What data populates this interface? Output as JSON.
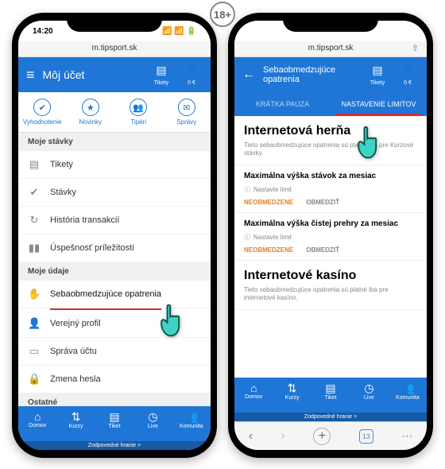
{
  "age_badge": "18+",
  "left": {
    "time": "14:20",
    "url": "m.tipsport.sk",
    "header_title": "Môj účet",
    "tikety_label": "Tikety",
    "balance": "0 €",
    "quick_tabs": [
      "Vyhodnotenie",
      "Novinky",
      "Tipéri",
      "Správy"
    ],
    "sec1": "Moje stávky",
    "rows1": [
      {
        "icon": "▤",
        "label": "Tikety"
      },
      {
        "icon": "✔",
        "label": "Stávky"
      },
      {
        "icon": "↻",
        "label": "História transakcií"
      },
      {
        "icon": "▮▮",
        "label": "Úspešnosť príležitostí"
      }
    ],
    "sec2": "Moje údaje",
    "rows2": [
      {
        "icon": "✋",
        "label": "Sebaobmedzujúce opatrenia"
      },
      {
        "icon": "👤",
        "label": "Verejný profil"
      },
      {
        "icon": "▭",
        "label": "Správa účtu"
      },
      {
        "icon": "🔒",
        "label": "Zmena hesla"
      }
    ],
    "sec3": "Ostatné",
    "nav": [
      "Domov",
      "Kurzy",
      "Tiket",
      "Live",
      "Komunita"
    ],
    "nav_icons": [
      "⌂",
      "⇅",
      "▤",
      "◷",
      "👥"
    ],
    "footer": "Zodpovedné hranie >"
  },
  "right": {
    "url": "m.tipsport.sk",
    "header_title": "Sebaobmedzujúce opatrenia",
    "tikety_label": "Tikety",
    "balance": "0 €",
    "tab_a": "KRÁTKA PAUZA",
    "tab_b": "NASTAVENIE LIMITOV",
    "sec1_title": "Internetová herňa",
    "sec1_sub": "Tieto sebaobmedzujúce opatrenia sú platné iba pre Kurzové stávky.",
    "limit1_title": "Maximálna výška stávok za mesiac",
    "limit_hint": "Nastavte limit",
    "act_unl": "NEOBMEDZENE",
    "act_lim": "OBMEDZIŤ",
    "limit2_title": "Maximálna výška čistej prehry za mesiac",
    "sec2_title": "Internetové kasíno",
    "sec2_sub": "Tieto sebaobmedzujúce opatrenia sú platné iba pre internetové kasíno.",
    "nav": [
      "Domov",
      "Kurzy",
      "Tiket",
      "Live",
      "Komunita"
    ],
    "nav_icons": [
      "⌂",
      "⇅",
      "▤",
      "◷",
      "👥"
    ],
    "footer": "Zodpovedné hranie >",
    "tab_count": "13"
  }
}
